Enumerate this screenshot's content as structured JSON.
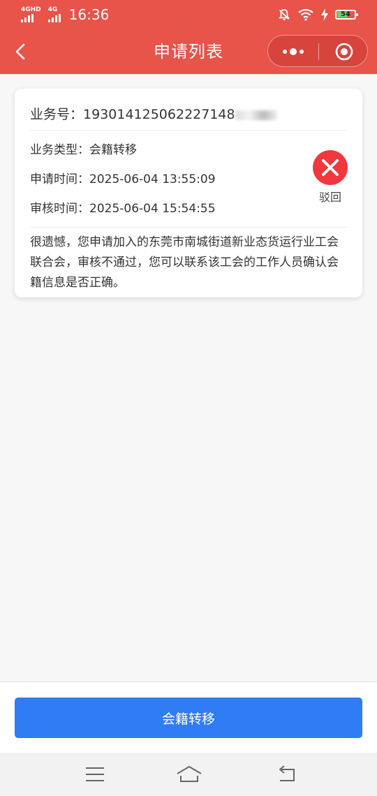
{
  "status_bar": {
    "network_1": "4GHD",
    "network_2": "4G",
    "time": "16:36",
    "battery": "54",
    "icons": [
      "signal-icon",
      "mute-bell-icon",
      "wifi-icon",
      "charging-bolt-icon",
      "battery-icon"
    ]
  },
  "nav": {
    "title": "申请列表",
    "icons": [
      "back-chevron-icon",
      "more-dots-icon",
      "target-circle-icon"
    ]
  },
  "record": {
    "business_no_label": "业务号：",
    "business_no_value": "193014125062227148",
    "type_label": "业务类型：",
    "type_value": "会籍转移",
    "apply_time_label": "申请时间：",
    "apply_time_value": "2025-06-04 13:55:09",
    "review_time_label": "审核时间：",
    "review_time_value": "2025-06-04 15:54:55",
    "status_label": "驳回",
    "status_icon": "reject-x-icon",
    "status_color": "#f0383e",
    "message": "很遗憾，您申请加入的东莞市南城街道新业态货运行业工会联合会，审核不通过，您可以联系该工会的工作人员确认会籍信息是否正确。"
  },
  "footer": {
    "button_label": "会籍转移",
    "button_color": "#2f7cf5"
  },
  "system_nav": {
    "icons": [
      "menu-lines-icon",
      "home-icon",
      "back-arrow-icon"
    ]
  }
}
